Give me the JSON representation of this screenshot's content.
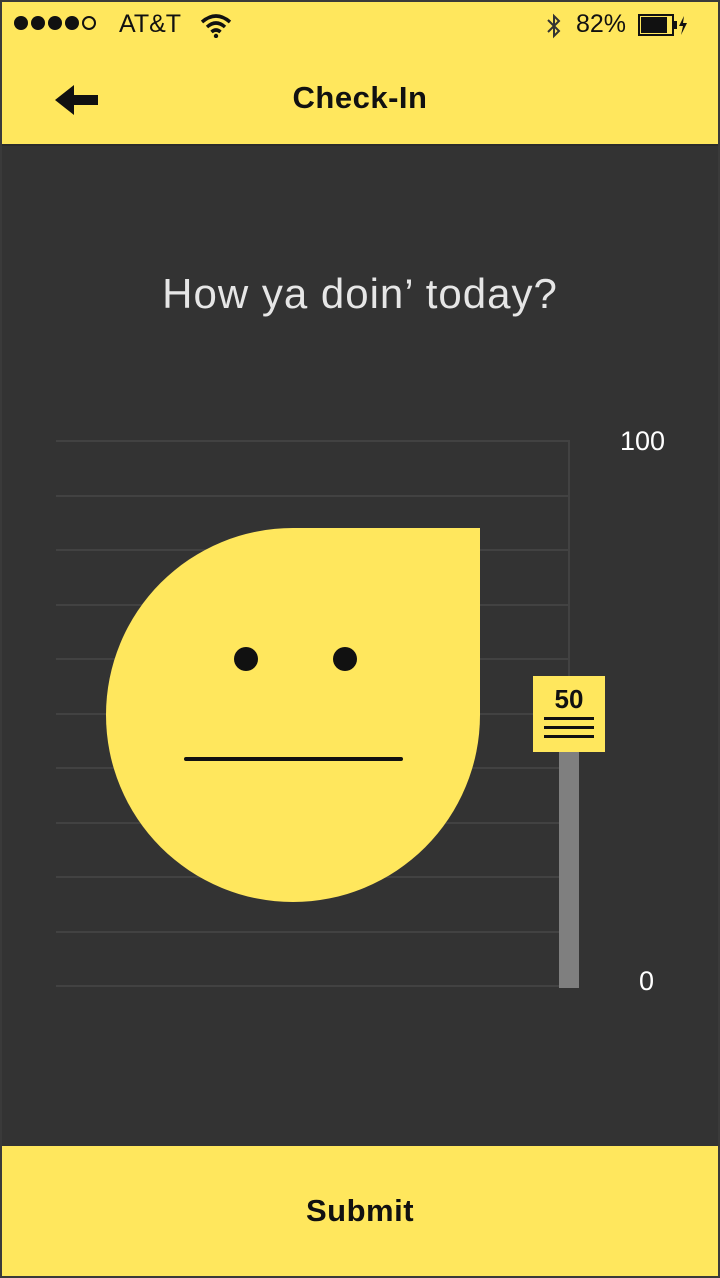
{
  "status_bar": {
    "carrier": "AT&T",
    "battery_percent": "82%"
  },
  "nav": {
    "title": "Check-In",
    "back_icon": "arrow-left-icon"
  },
  "main": {
    "question": "How ya doin’ today?",
    "scale": {
      "max_label": "100",
      "min_label": "0"
    },
    "slider": {
      "value": "50"
    },
    "face_icon": "neutral-face-icon"
  },
  "footer": {
    "submit_label": "Submit"
  },
  "colors": {
    "accent": "#ffe75d",
    "background": "#333333",
    "track": "#7f7f7f"
  }
}
